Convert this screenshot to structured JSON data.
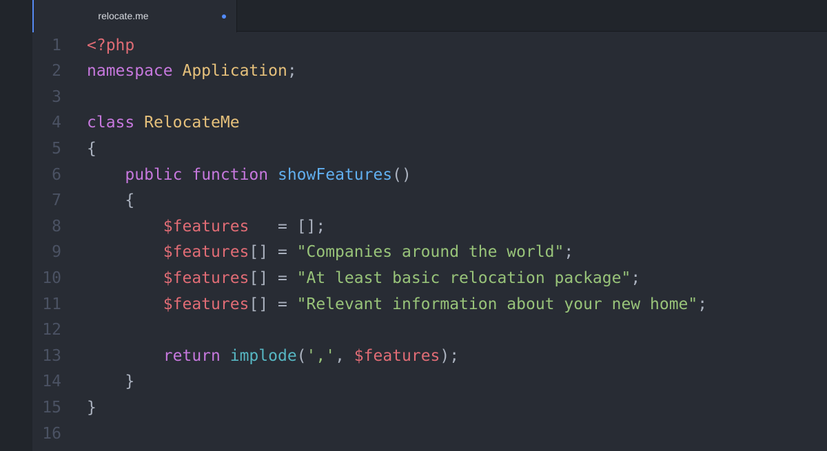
{
  "tab": {
    "title": "relocate.me",
    "modified": true
  },
  "colors": {
    "background": "#282c34",
    "keyword": "#c678dd",
    "class_name": "#e5c07b",
    "function": "#61afef",
    "builtin": "#56b6c2",
    "variable": "#e06c75",
    "string": "#98c379",
    "plain": "#abb2bf",
    "line_number": "#4b5263",
    "accent": "#528bff"
  },
  "editor": {
    "lines": [
      {
        "number": "1",
        "indent": 0,
        "tokens": [
          {
            "t": "<?php",
            "c": "variable"
          }
        ]
      },
      {
        "number": "2",
        "indent": 0,
        "tokens": [
          {
            "t": "namespace",
            "c": "keyword"
          },
          {
            "t": " ",
            "c": "plain"
          },
          {
            "t": "Application",
            "c": "class_name"
          },
          {
            "t": ";",
            "c": "plain"
          }
        ]
      },
      {
        "number": "3",
        "indent": 0,
        "tokens": []
      },
      {
        "number": "4",
        "indent": 0,
        "tokens": [
          {
            "t": "class",
            "c": "keyword"
          },
          {
            "t": " ",
            "c": "plain"
          },
          {
            "t": "RelocateMe",
            "c": "class_name"
          }
        ]
      },
      {
        "number": "5",
        "indent": 0,
        "tokens": [
          {
            "t": "{",
            "c": "plain"
          }
        ]
      },
      {
        "number": "6",
        "indent": 0,
        "tokens": [
          {
            "t": "    ",
            "c": "plain"
          },
          {
            "t": "public",
            "c": "keyword"
          },
          {
            "t": " ",
            "c": "plain"
          },
          {
            "t": "function",
            "c": "keyword"
          },
          {
            "t": " ",
            "c": "plain"
          },
          {
            "t": "showFeatures",
            "c": "function"
          },
          {
            "t": "()",
            "c": "plain"
          }
        ]
      },
      {
        "number": "7",
        "indent": 0,
        "tokens": [
          {
            "t": "    ",
            "c": "plain"
          },
          {
            "t": "{",
            "c": "plain"
          }
        ]
      },
      {
        "number": "8",
        "indent": 0,
        "tokens": [
          {
            "t": "        ",
            "c": "plain"
          },
          {
            "t": "$features",
            "c": "variable"
          },
          {
            "t": "   = [];",
            "c": "plain"
          }
        ]
      },
      {
        "number": "9",
        "indent": 0,
        "tokens": [
          {
            "t": "        ",
            "c": "plain"
          },
          {
            "t": "$features",
            "c": "variable"
          },
          {
            "t": "[] = ",
            "c": "plain"
          },
          {
            "t": "\"Companies around the world\"",
            "c": "string"
          },
          {
            "t": ";",
            "c": "plain"
          }
        ]
      },
      {
        "number": "10",
        "indent": 0,
        "tokens": [
          {
            "t": "        ",
            "c": "plain"
          },
          {
            "t": "$features",
            "c": "variable"
          },
          {
            "t": "[] = ",
            "c": "plain"
          },
          {
            "t": "\"At least basic relocation package\"",
            "c": "string"
          },
          {
            "t": ";",
            "c": "plain"
          }
        ]
      },
      {
        "number": "11",
        "indent": 0,
        "tokens": [
          {
            "t": "        ",
            "c": "plain"
          },
          {
            "t": "$features",
            "c": "variable"
          },
          {
            "t": "[] = ",
            "c": "plain"
          },
          {
            "t": "\"Relevant information about your new home\"",
            "c": "string"
          },
          {
            "t": ";",
            "c": "plain"
          }
        ]
      },
      {
        "number": "12",
        "indent": 0,
        "tokens": []
      },
      {
        "number": "13",
        "indent": 0,
        "tokens": [
          {
            "t": "        ",
            "c": "plain"
          },
          {
            "t": "return",
            "c": "keyword"
          },
          {
            "t": " ",
            "c": "plain"
          },
          {
            "t": "implode",
            "c": "builtin"
          },
          {
            "t": "(",
            "c": "plain"
          },
          {
            "t": "','",
            "c": "string"
          },
          {
            "t": ", ",
            "c": "plain"
          },
          {
            "t": "$features",
            "c": "variable"
          },
          {
            "t": ");",
            "c": "plain"
          }
        ]
      },
      {
        "number": "14",
        "indent": 0,
        "tokens": [
          {
            "t": "    ",
            "c": "plain"
          },
          {
            "t": "}",
            "c": "plain"
          }
        ]
      },
      {
        "number": "15",
        "indent": 0,
        "tokens": [
          {
            "t": "}",
            "c": "plain"
          }
        ]
      },
      {
        "number": "16",
        "indent": 0,
        "tokens": []
      }
    ]
  }
}
